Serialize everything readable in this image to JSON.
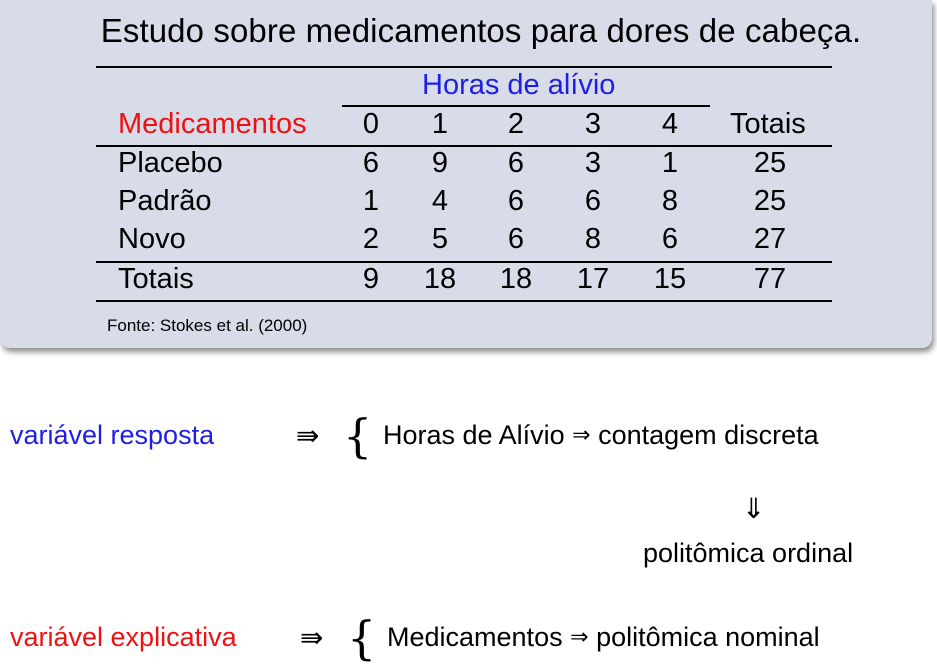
{
  "title": "Estudo sobre medicamentos para dores de cabeça.",
  "table": {
    "group_header": "Horas de alívio",
    "row_header": "Medicamentos",
    "columns": [
      "0",
      "1",
      "2",
      "3",
      "4"
    ],
    "total_header": "Totais",
    "rows": [
      {
        "label": "Placebo",
        "values": [
          "6",
          "9",
          "6",
          "3",
          "1"
        ],
        "total": "25"
      },
      {
        "label": "Padrão",
        "values": [
          "1",
          "4",
          "6",
          "6",
          "8"
        ],
        "total": "25"
      },
      {
        "label": "Novo",
        "values": [
          "2",
          "5",
          "6",
          "8",
          "6"
        ],
        "total": "27"
      }
    ],
    "totals": {
      "label": "Totais",
      "values": [
        "9",
        "18",
        "18",
        "17",
        "15"
      ],
      "total": "77"
    }
  },
  "source": "Fonte: Stokes et al. (2000)",
  "response": {
    "label": "variável resposta",
    "arrow": "⇛",
    "brace": "{",
    "item": "Horas de Alívio",
    "implies": "⇒",
    "type": "contagem discreta",
    "down_arrow": "⇓",
    "result": "politômica ordinal"
  },
  "explanatory": {
    "label": "variável explicativa",
    "arrow": "⇛",
    "brace": "{",
    "item": "Medicamentos",
    "implies": "⇒",
    "type": "politômica nominal"
  },
  "colors": {
    "panel": "#d8dce9",
    "blue": "#1e1ee6",
    "red": "#ee1111"
  }
}
